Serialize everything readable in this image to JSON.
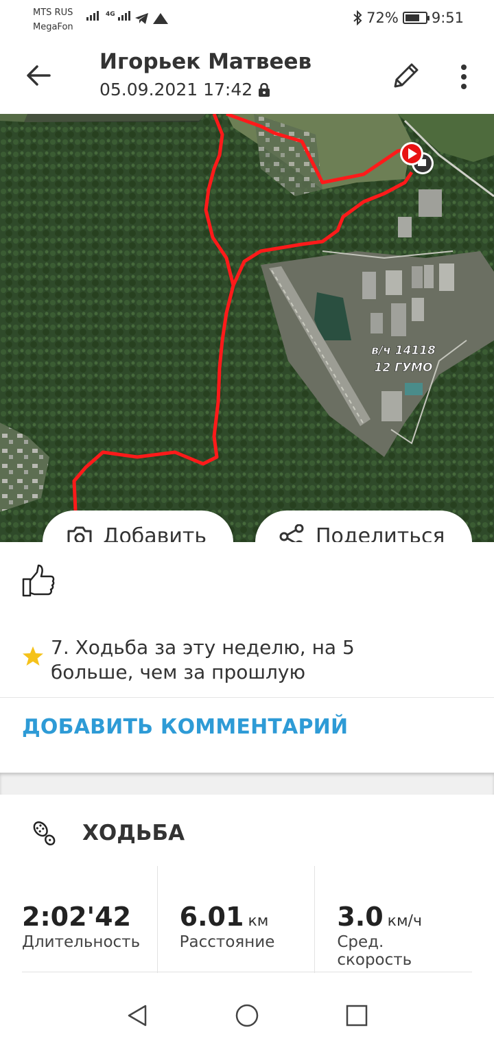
{
  "status_bar": {
    "carrier1": "MTS RUS",
    "carrier2": "MegaFon",
    "network": "4G",
    "battery": "72%",
    "battery_level": 0.72,
    "time": "9:51"
  },
  "header": {
    "title": "Игорьек Матвеев",
    "datetime": "05.09.2021 17:42"
  },
  "map": {
    "label_line1": "в/ч 14118",
    "label_line2": "12 ГУМО",
    "track_color": "#ff1a1a",
    "add_button_label": "Добавить",
    "share_button_label": "Поделиться"
  },
  "social": {
    "achievement": "7. Ходьба за эту неделю, на 5 больше, чем за прошлую",
    "add_comment": "ДОБАВИТЬ КОММЕНТАРИЙ",
    "accent_color": "#2e9bd6"
  },
  "activity": {
    "type": "ХОДЬБА",
    "stats": [
      {
        "value": "2:02'42",
        "unit": "",
        "label": "Длительность"
      },
      {
        "value": "6.01",
        "unit": "км",
        "label": "Расстояние"
      },
      {
        "value": "3.0",
        "unit": "км/ч",
        "label": "Сред. скорость"
      }
    ]
  },
  "icons": {
    "back": "arrow-left-icon",
    "edit": "pencil-icon",
    "more": "more-vertical-icon",
    "lock": "lock-icon",
    "like": "thumbs-up-icon",
    "star": "star-icon",
    "activity": "shoe-sole-icon",
    "camera": "camera-icon",
    "share": "share-icon"
  }
}
